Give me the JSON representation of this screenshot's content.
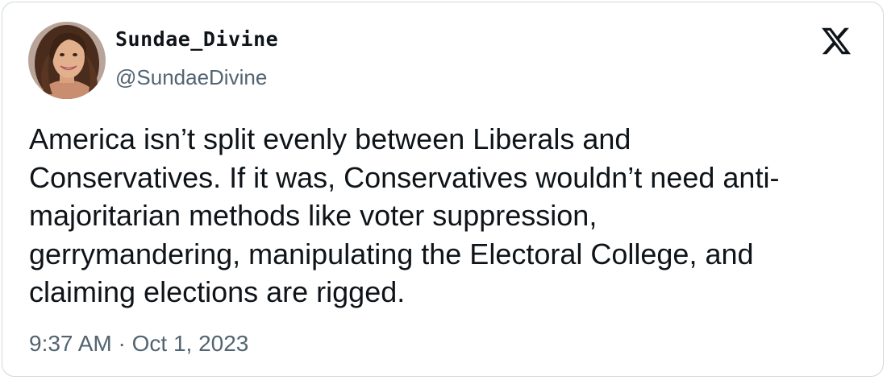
{
  "author": {
    "display_name": "Sundae_Divine",
    "handle": "@SundaeDivine",
    "avatar_icon": "profile-photo"
  },
  "tweet": {
    "lines": [
      "America isn’t split evenly between Liberals and",
      "Conservatives. If it was, Conservatives wouldn’t need anti-",
      "majoritarian methods like voter suppression,",
      "gerrymandering, manipulating the Electoral College, and",
      "claiming elections are rigged."
    ],
    "timestamp": "9:37 AM · Oct 1, 2023"
  },
  "brand": {
    "logo_icon": "x-logo-icon",
    "logo_color": "#0f1419"
  },
  "colors": {
    "text_primary": "#0f1419",
    "text_secondary": "#536471",
    "border": "#cfd9de"
  }
}
